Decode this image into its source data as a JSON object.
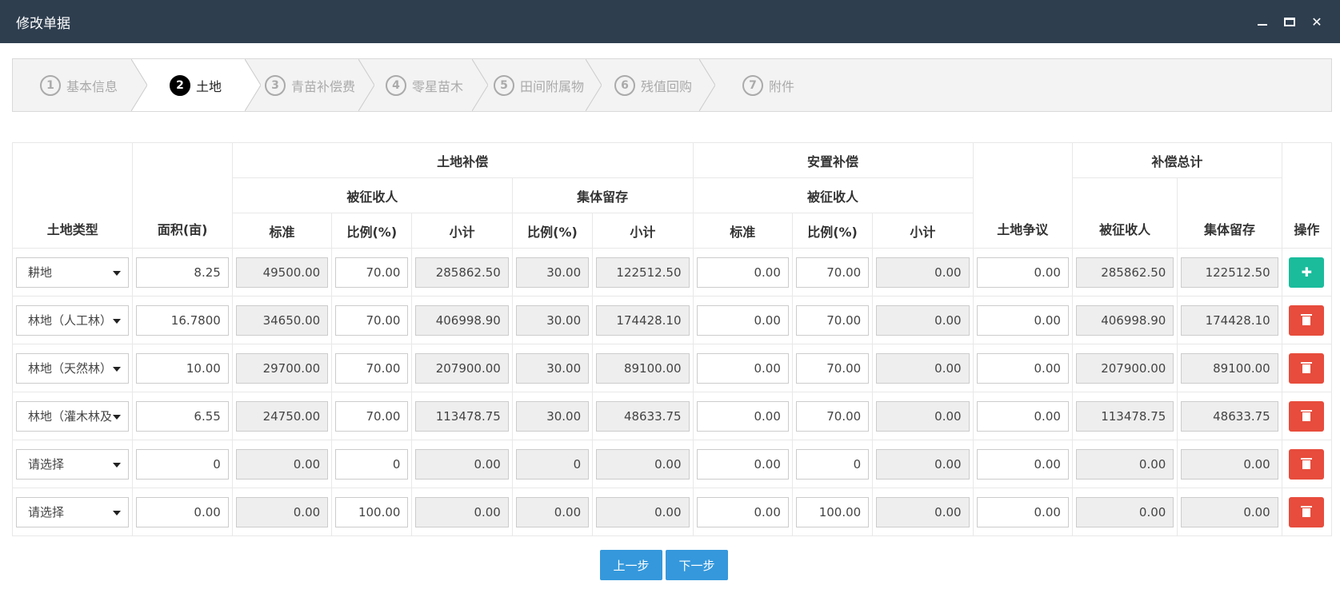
{
  "window": {
    "title": "修改单据"
  },
  "steps": [
    {
      "num": "1",
      "label": "基本信息"
    },
    {
      "num": "2",
      "label": "土地"
    },
    {
      "num": "3",
      "label": "青苗补偿费"
    },
    {
      "num": "4",
      "label": "零星苗木"
    },
    {
      "num": "5",
      "label": "田间附属物"
    },
    {
      "num": "6",
      "label": "残值回购"
    },
    {
      "num": "7",
      "label": "附件"
    }
  ],
  "active_step": 2,
  "table": {
    "headers": {
      "land_type": "土地类型",
      "area": "面积(亩)",
      "land_comp": "土地补偿",
      "resettle_comp": "安置补偿",
      "total_comp": "补偿总计",
      "bzsr": "被征收人",
      "jtlc": "集体留存",
      "bzsr2": "被征收人",
      "standard": "标准",
      "ratio": "比例(%)",
      "subtotal": "小计",
      "ratio2": "比例(%)",
      "subtotal2": "小计",
      "standard3": "标准",
      "ratio3": "比例(%)",
      "subtotal3": "小计",
      "dispute": "土地争议",
      "total_bzsr": "被征收人",
      "total_jtlc": "集体留存",
      "ops": "操作"
    },
    "rows": [
      {
        "type": "耕地",
        "area": "8.25",
        "std": "49500.00",
        "ratio": "70.00",
        "sub": "285862.50",
        "c_ratio": "30.00",
        "c_sub": "122512.50",
        "r_std": "0.00",
        "r_ratio": "70.00",
        "r_sub": "0.00",
        "dispute": "0.00",
        "t_bzsr": "285862.50",
        "t_jtlc": "122512.50",
        "action": "add"
      },
      {
        "type": "林地（人工林）",
        "area": "16.7800",
        "std": "34650.00",
        "ratio": "70.00",
        "sub": "406998.90",
        "c_ratio": "30.00",
        "c_sub": "174428.10",
        "r_std": "0.00",
        "r_ratio": "70.00",
        "r_sub": "0.00",
        "dispute": "0.00",
        "t_bzsr": "406998.90",
        "t_jtlc": "174428.10",
        "action": "delete"
      },
      {
        "type": "林地（天然林）",
        "area": "10.00",
        "std": "29700.00",
        "ratio": "70.00",
        "sub": "207900.00",
        "c_ratio": "30.00",
        "c_sub": "89100.00",
        "r_std": "0.00",
        "r_ratio": "70.00",
        "r_sub": "0.00",
        "dispute": "0.00",
        "t_bzsr": "207900.00",
        "t_jtlc": "89100.00",
        "action": "delete"
      },
      {
        "type": "林地（灌木林及",
        "area": "6.55",
        "std": "24750.00",
        "ratio": "70.00",
        "sub": "113478.75",
        "c_ratio": "30.00",
        "c_sub": "48633.75",
        "r_std": "0.00",
        "r_ratio": "70.00",
        "r_sub": "0.00",
        "dispute": "0.00",
        "t_bzsr": "113478.75",
        "t_jtlc": "48633.75",
        "action": "delete"
      },
      {
        "type": "请选择",
        "area": "0",
        "std": "0.00",
        "ratio": "0",
        "sub": "0.00",
        "c_ratio": "0",
        "c_sub": "0.00",
        "r_std": "0.00",
        "r_ratio": "0",
        "r_sub": "0.00",
        "dispute": "0.00",
        "t_bzsr": "0.00",
        "t_jtlc": "0.00",
        "action": "delete"
      },
      {
        "type": "请选择",
        "area": "0.00",
        "std": "0.00",
        "ratio": "100.00",
        "sub": "0.00",
        "c_ratio": "0.00",
        "c_sub": "0.00",
        "r_std": "0.00",
        "r_ratio": "100.00",
        "r_sub": "0.00",
        "dispute": "0.00",
        "t_bzsr": "0.00",
        "t_jtlc": "0.00",
        "action": "delete"
      }
    ]
  },
  "nav": {
    "prev": "上一步",
    "next": "下一步"
  },
  "colors": {
    "titlebar": "#2e3e4f",
    "add": "#1abc9c",
    "delete": "#e74c3c",
    "primary": "#3598dc"
  }
}
